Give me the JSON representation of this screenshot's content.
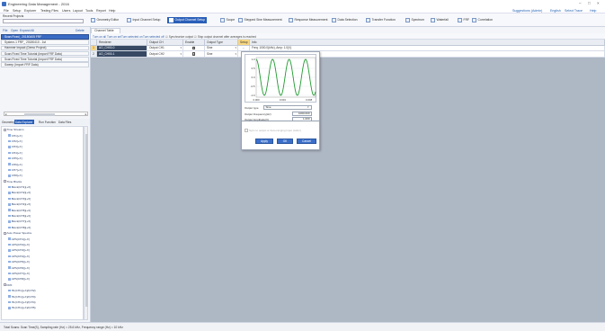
{
  "window": {
    "title": "Engineering Data Management - 2016",
    "controls": [
      "–",
      "□",
      "×"
    ]
  },
  "menu": {
    "items": [
      "File",
      "Setup",
      "Explorer",
      "Testing Files",
      "Users",
      "Layout",
      "Tools",
      "Report",
      "Help"
    ],
    "right": [
      "Suggestions (Admin)",
      "English",
      "Select Trace",
      "Help"
    ]
  },
  "toolbar": {
    "section_label": "Recent Projects",
    "buttons": [
      "Geometry Editor",
      "Input Channel Setup",
      "Output Channel Setup",
      "Scope",
      "Stepped Sine Measurement",
      "Response Measurement",
      "Data Selection",
      "Transfer Function",
      "Spectrum",
      "Waterfall",
      "FRF",
      "Correlation"
    ]
  },
  "left_panel": {
    "tabs": [
      "File",
      "Open",
      "Expand All",
      "Delete"
    ],
    "projects": [
      "Scan Fixed_ 20180405 FRF",
      "System-1 FRF_ 20180410 - 1st",
      "Hammer Impact (Demo Project)",
      "Scan Fixed Time Tutorial (Import FRF Data)",
      "Scan Fixed Time Tutorial (Import FRF Data)",
      "Sweep (Import FRF Data)"
    ],
    "bottom_tabs": [
      "Geometry",
      "Data Explorer",
      "Run Function",
      "Data Files"
    ],
    "tree": [
      {
        "label": "Time Streams",
        "level": 0
      },
      {
        "label": "CH1[+X]",
        "level": 1
      },
      {
        "label": "CH2[+X]",
        "level": 1
      },
      {
        "label": "CH3[+X]",
        "level": 1
      },
      {
        "label": "CH4[+X]",
        "level": 1
      },
      {
        "label": "CH5[+X]",
        "level": 1
      },
      {
        "label": "CH6[+X]",
        "level": 1
      },
      {
        "label": "CH7[+X]",
        "level": 1
      },
      {
        "label": "CH8[+X]",
        "level": 1
      },
      {
        "label": "Time Blocks",
        "level": 0
      },
      {
        "label": "Block(CH1)[+X]",
        "level": 1
      },
      {
        "label": "Block(CH2)[+X]",
        "level": 1
      },
      {
        "label": "Block(CH3)[+X]",
        "level": 1
      },
      {
        "label": "Block(CH4)[+X]",
        "level": 1
      },
      {
        "label": "Block(CH5)[+X]",
        "level": 1
      },
      {
        "label": "Block(CH6)[+X]",
        "level": 1
      },
      {
        "label": "Block(CH7)[+X]",
        "level": 1
      },
      {
        "label": "Block(CH8)[+X]",
        "level": 1
      },
      {
        "label": "Auto Power Spectra",
        "level": 0
      },
      {
        "label": "APS(CH1)[+X]",
        "level": 1
      },
      {
        "label": "APS(CH2)[+X]",
        "level": 1
      },
      {
        "label": "APS(CH3)[+X]",
        "level": 1
      },
      {
        "label": "APS(CH4)[+X]",
        "level": 1
      },
      {
        "label": "APS(CH5)[+X]",
        "level": 1
      },
      {
        "label": "APS(CH6)[+X]",
        "level": 1
      },
      {
        "label": "APS(CH7)[+X]",
        "level": 1
      },
      {
        "label": "APS(CH8)[+X]",
        "level": 1
      },
      {
        "label": "FRF",
        "level": 0
      },
      {
        "label": "H1(CH1)[+X]/(CH2)",
        "level": 1
      },
      {
        "label": "H1(CH1)[+X]/(CH3)",
        "level": 1
      },
      {
        "label": "H1(CH1)[+X]/(CH4)",
        "level": 1
      },
      {
        "label": "H1(CH1)[+X]/(CH5)",
        "level": 1
      }
    ]
  },
  "document": {
    "tab": "Channel Table",
    "commands": [
      "Turn on all",
      "Turn on sel",
      "Turn selected on",
      "Turn selected off",
      "Synchronize output",
      "Stop output channel after averages is reached"
    ],
    "columns": [
      "Renderer",
      "Output CH",
      "Enable",
      "Output Type",
      "Setup",
      "Info"
    ],
    "rows": [
      {
        "no": "1",
        "name": "AO_CH00-0",
        "output": "Output CH1",
        "enabled": "☑",
        "type": "Sine",
        "setup": "...",
        "info": "Freq: 1000.0(kHz), Amp: 1.0(V)"
      },
      {
        "no": "2",
        "name": "AO_CH00-1",
        "output": "Output CH2",
        "enabled": "☑",
        "type": "Sine",
        "setup": "",
        "info": ""
      }
    ]
  },
  "popup": {
    "chart_data": {
      "type": "line",
      "title": "",
      "xlabel": "",
      "ylabel": "",
      "x_ticks": [
        "0.000",
        "0.004",
        "0.008"
      ],
      "y_ticks": [
        "1.0",
        "0.5",
        "0.0",
        "-0.5",
        "-1.0"
      ],
      "xlim": [
        0,
        0.009
      ],
      "ylim": [
        -1.1,
        1.1
      ],
      "series": [
        {
          "frequency_hz": 1000,
          "amplitude": 1.0,
          "color": "#1f9a2f"
        }
      ]
    },
    "output_type_label": "Output type",
    "output_type_value": "Sine",
    "fields": [
      {
        "label": "Output Frequency(Hz)",
        "value": "1000.000"
      },
      {
        "label": "Output Amplitude(V)",
        "value": "1.000"
      },
      {
        "label": "Offset (V)",
        "value": "0.00"
      }
    ],
    "checkbox_label": "Sync to output or Auto-ranging Input (AiAm)",
    "buttons": [
      "Apply",
      "OK",
      "Cancel"
    ]
  },
  "status": {
    "text": "Total Scans: Scan Time(S), Sampling rate (Hz) = 25.6 kHz, Frequency range (Hz) = 10 kHz"
  }
}
